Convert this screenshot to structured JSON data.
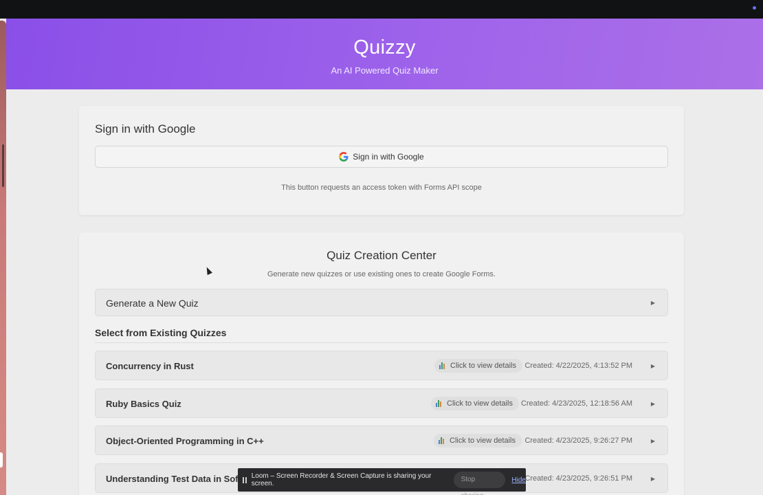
{
  "header": {
    "title": "Quizzy",
    "subtitle": "An AI Powered Quiz Maker"
  },
  "signin": {
    "title": "Sign in with Google",
    "button_label": "Sign in with Google",
    "note": "This button requests an access token with Forms API scope"
  },
  "quiz_center": {
    "title": "Quiz Creation Center",
    "subtitle": "Generate new quizzes or use existing ones to create Google Forms.",
    "generate_label": "Generate a New Quiz",
    "existing_title": "Select from Existing Quizzes",
    "quizzes": [
      {
        "title": "Concurrency in Rust",
        "details": "Click to view details",
        "created": "Created: 4/22/2025, 4:13:52 PM"
      },
      {
        "title": "Ruby Basics Quiz",
        "details": "Click to view details",
        "created": "Created: 4/23/2025, 12:18:56 AM"
      },
      {
        "title": "Object-Oriented Programming in C++",
        "details": "Click to view details",
        "created": "Created: 4/23/2025, 9:26:27 PM"
      },
      {
        "title": "Understanding Test Data in Sof",
        "created": "Created: 4/23/2025, 9:26:51 PM"
      }
    ]
  },
  "loom": {
    "message": "Loom – Screen Recorder & Screen Capture is sharing your screen.",
    "stop_label": "Stop sharing",
    "hide_label": "Hide"
  },
  "icons": {
    "google": "google-g-icon",
    "chart": "bar-chart-icon",
    "arrow": "play-arrow-icon",
    "pause": "pause-icon"
  },
  "colors": {
    "header_gradient_start": "#8a4fe8",
    "header_gradient_end": "#ab6fe8",
    "background": "#ececec",
    "card": "#f1f1f1"
  }
}
